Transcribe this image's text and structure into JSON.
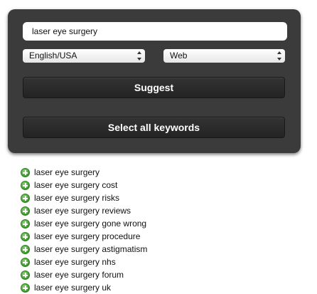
{
  "search": {
    "value": "laser eye surgery"
  },
  "language_select": {
    "selected": "English/USA"
  },
  "source_select": {
    "selected": "Web"
  },
  "buttons": {
    "suggest_label": "Suggest",
    "select_all_label": "Select all keywords"
  },
  "keywords": [
    "laser eye surgery",
    "laser eye surgery cost",
    "laser eye surgery risks",
    "laser eye surgery reviews",
    "laser eye surgery gone wrong",
    "laser eye surgery procedure",
    "laser eye surgery astigmatism",
    "laser eye surgery nhs",
    "laser eye surgery forum",
    "laser eye surgery uk"
  ],
  "icons": {
    "add": "plus-circle-icon"
  },
  "colors": {
    "panel": "#3b3b3b",
    "add_icon": "#3d9a2e"
  }
}
